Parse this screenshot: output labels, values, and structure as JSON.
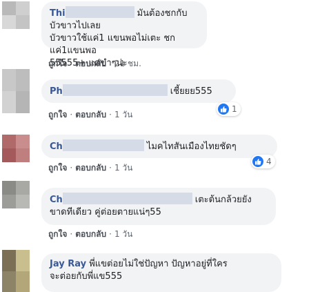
{
  "labels": {
    "like": "ถูกใจ",
    "reply": "ตอบกลับ",
    "dot": "·"
  },
  "colors": {
    "like_blue": "#2078f4",
    "name_blue": "#385898",
    "bubble_bg": "#f2f3f5"
  },
  "comments": [
    {
      "name": "Thi",
      "line1": "มันต้องชกกับบัวขาวไปเลย",
      "line2": "บัวขาวใช้แค่1 แขนพอไม่เตะ ชกแค่1แขนพอ",
      "line3": "55555+ แค่ขำๆน่ะ",
      "time": "21 ชม."
    },
    {
      "name": "Ph",
      "line1": "เชี้ยยย555",
      "time": "1 วัน",
      "reactions": "1"
    },
    {
      "name": "Ch",
      "line1": "ไมคไทสันเมืองไทยชัดๆ",
      "time": "1 วัน",
      "reactions": "4"
    },
    {
      "name": "Ch",
      "line1": "เตะต้นกล้วยยัง",
      "line2": "ขาดทีเดียว คู่ต่อยตายแน่ๆ55",
      "time": "1 วัน"
    },
    {
      "name": "Jay Ray",
      "line1": "พี่แขต่อยไม่ใช่ปัญหา ปัญหาอยู่ที่ใคร",
      "line2": "จะต่อยกับพี่แข555"
    }
  ]
}
